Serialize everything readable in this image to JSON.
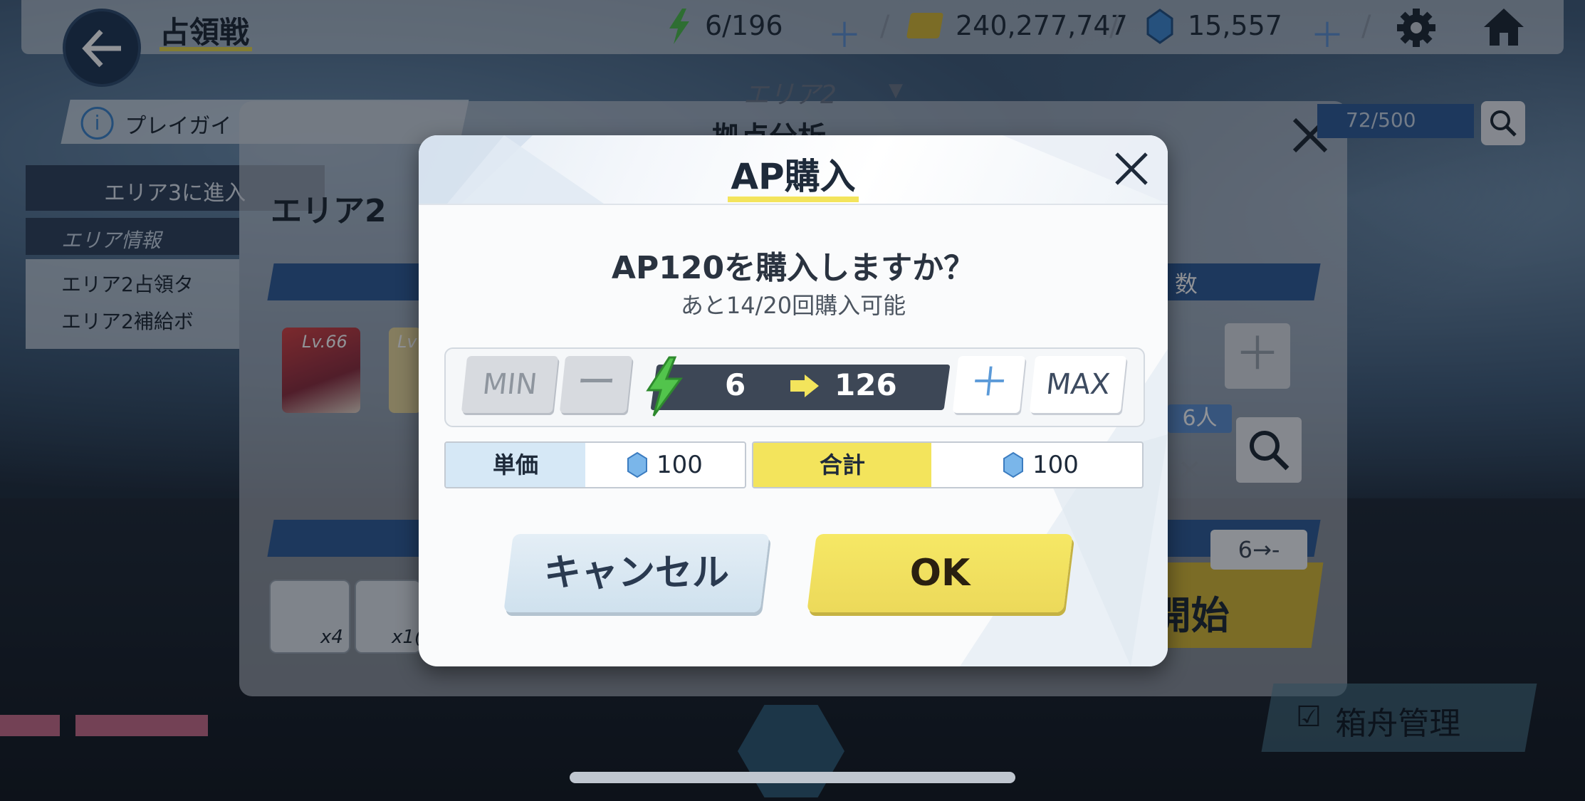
{
  "header": {
    "title": "占領戦",
    "ap": "6/196",
    "gold": "240,277,747",
    "gems": "15,557"
  },
  "background": {
    "area_selector": "エリア2",
    "guide_label": "プレイガイ",
    "panel_title": "拠点分析",
    "area_tab": "エリア2",
    "progress_text": "72/500",
    "warn_text": "エリア3に進入",
    "area_info_header": "エリア情報",
    "checklist": [
      "エリア2占領タ",
      "エリア2補給ボ"
    ],
    "card_level": "Lv.66",
    "card_level_2": "Lv",
    "people_count": "6人",
    "count_header": "数",
    "item_counts": [
      "x4",
      "x1("
    ],
    "start_label": "開始",
    "ap_hint": "6→-",
    "ark_button": "箱舟管理"
  },
  "dialog": {
    "title": "AP購入",
    "question": "AP120を購入しますか？",
    "remaining": "あと14/20回購入可能",
    "min_label": "MIN",
    "minus_label": "ー",
    "plus_label": "＋",
    "max_label": "MAX",
    "ap_from": "6",
    "ap_to": "126",
    "unit_price_label": "単価",
    "unit_price_value": "100",
    "total_label": "合計",
    "total_value": "100",
    "cancel_label": "キャンセル",
    "ok_label": "OK"
  },
  "colors": {
    "accent_yellow": "#f3e45c",
    "ap_bar": "#3d4756",
    "unit_label_bg": "#d6e8f6",
    "total_label_bg": "#f3e45c"
  }
}
